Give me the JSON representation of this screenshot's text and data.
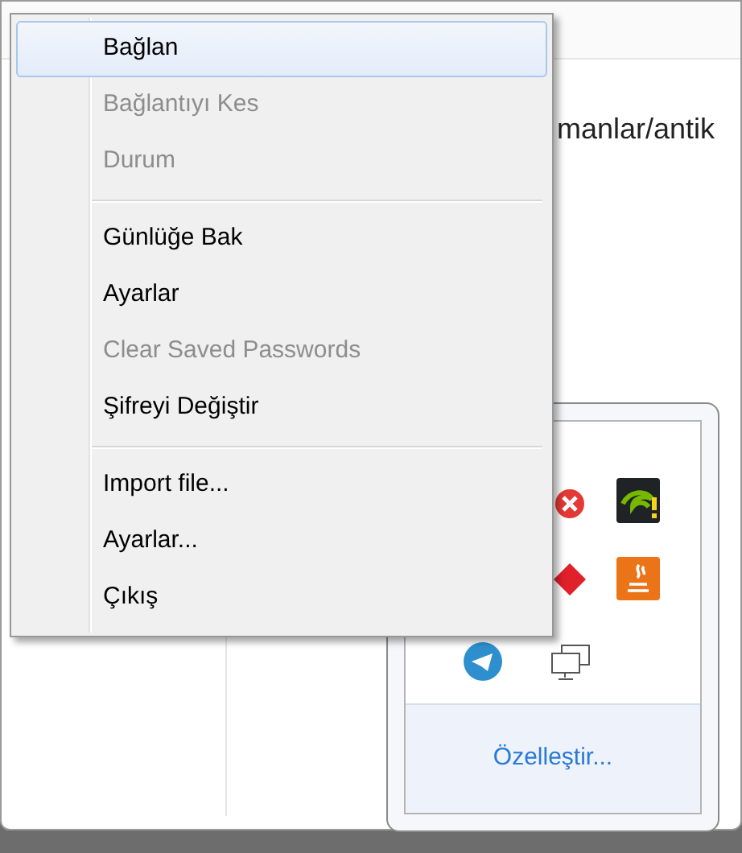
{
  "background": {
    "path_text": "manlar/antik"
  },
  "menu": {
    "items": [
      {
        "kind": "item",
        "label": "Bağlan",
        "selected": true,
        "disabled": false
      },
      {
        "kind": "item",
        "label": "Bağlantıyı Kes",
        "selected": false,
        "disabled": true
      },
      {
        "kind": "item",
        "label": "Durum",
        "selected": false,
        "disabled": true
      },
      {
        "kind": "separator"
      },
      {
        "kind": "item",
        "label": "Günlüğe Bak",
        "selected": false,
        "disabled": false
      },
      {
        "kind": "item",
        "label": "Ayarlar",
        "selected": false,
        "disabled": false
      },
      {
        "kind": "item",
        "label": "Clear Saved Passwords",
        "selected": false,
        "disabled": true
      },
      {
        "kind": "item",
        "label": "Şifreyi Değiştir",
        "selected": false,
        "disabled": false
      },
      {
        "kind": "separator"
      },
      {
        "kind": "item",
        "label": "Import file...",
        "selected": false,
        "disabled": false
      },
      {
        "kind": "item",
        "label": "Ayarlar...",
        "selected": false,
        "disabled": false
      },
      {
        "kind": "item",
        "label": "Çıkış",
        "selected": false,
        "disabled": false
      }
    ]
  },
  "tray": {
    "customize_link": "Özelleştir..."
  }
}
